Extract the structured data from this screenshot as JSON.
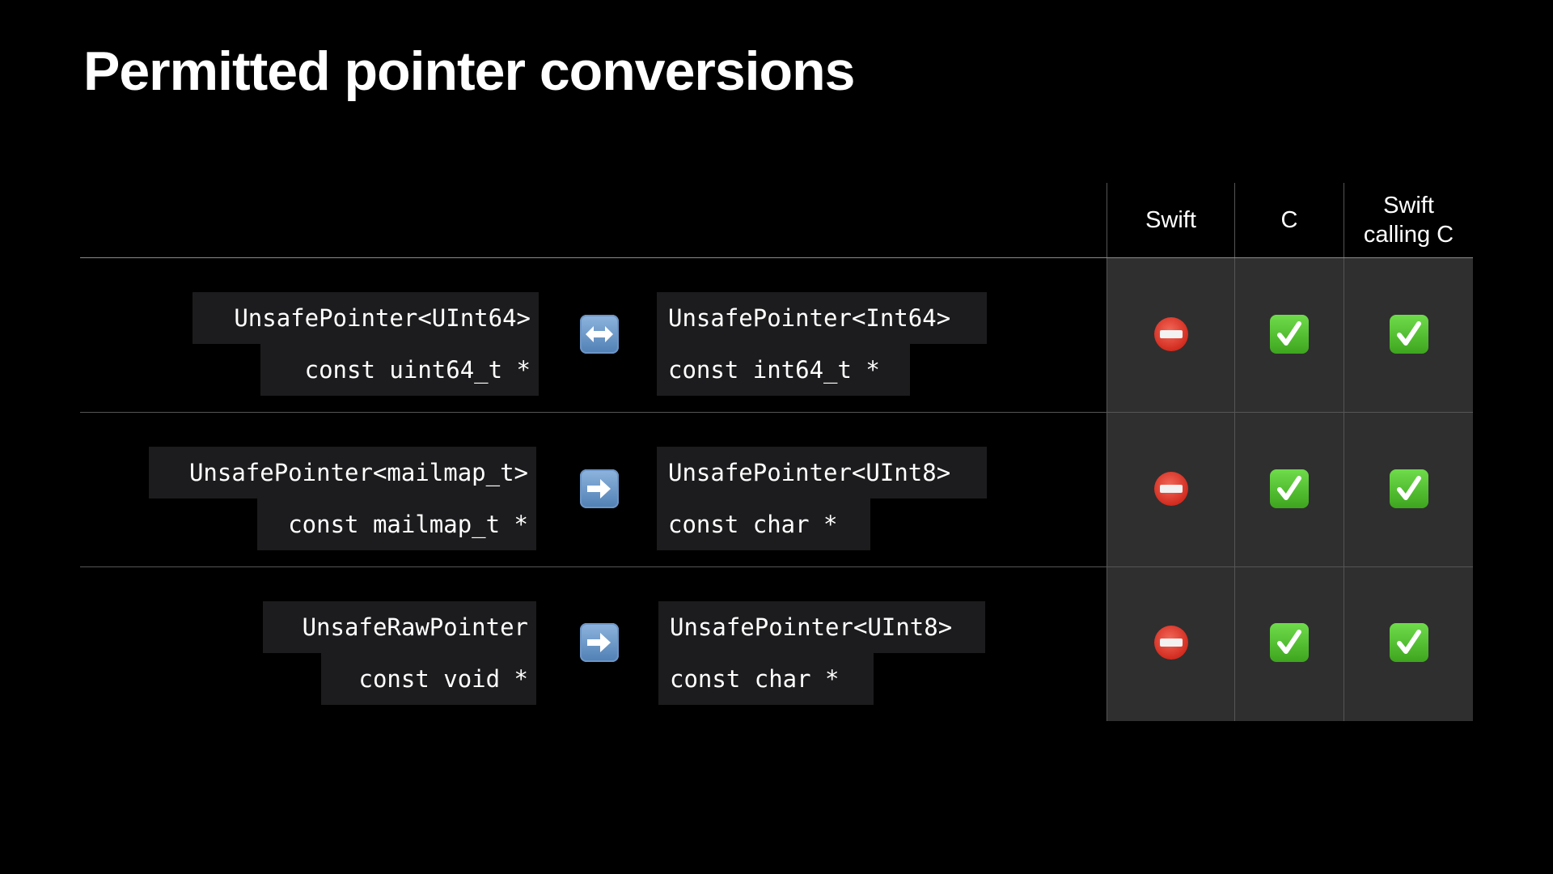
{
  "title": "Permitted pointer conversions",
  "columns": [
    "Swift",
    "C",
    "Swift calling C"
  ],
  "rows": [
    {
      "from_swift": "UnsafePointer<UInt64>",
      "from_c": "const uint64_t *",
      "relation": "bidirectional",
      "to_swift": "UnsafePointer<Int64>",
      "to_c": "const int64_t *",
      "results": [
        "not permitted",
        "permitted",
        "permitted"
      ]
    },
    {
      "from_swift": "UnsafePointer<mailmap_t>",
      "from_c": "const mailmap_t *",
      "relation": "one-way",
      "to_swift": "UnsafePointer<UInt8>",
      "to_c": "const char *",
      "results": [
        "not permitted",
        "permitted",
        "permitted"
      ]
    },
    {
      "from_swift": "UnsafeRawPointer",
      "from_c": "const void *",
      "relation": "one-way",
      "to_swift": "UnsafePointer<UInt8>",
      "to_c": "const char *",
      "results": [
        "not permitted",
        "permitted",
        "permitted"
      ]
    }
  ],
  "icons": {
    "bidirectional": "left-right-arrow-icon",
    "one_way": "right-arrow-icon",
    "not_permitted": "no-entry-icon",
    "permitted": "check-mark-icon"
  },
  "colors": {
    "background": "#000000",
    "code_background": "#1c1c1e",
    "panel_background": "#2f2f2f",
    "no_entry": "#d22c1f",
    "check": "#3da51e",
    "arrow": "#4f7fb4"
  }
}
